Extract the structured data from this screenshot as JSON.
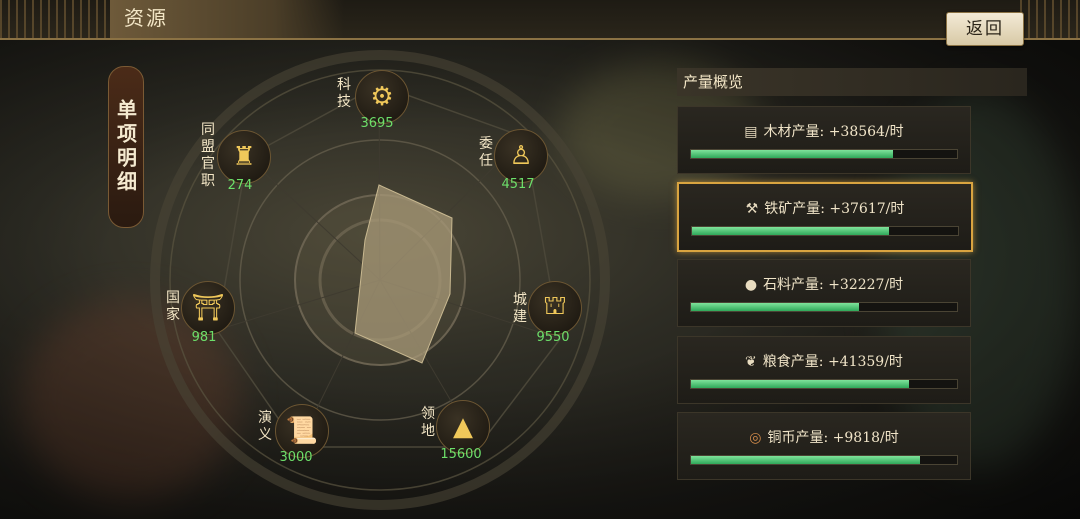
{
  "header": {
    "title": "资源",
    "back_label": "返回"
  },
  "side_tab": {
    "label": "单项明细"
  },
  "radar": {
    "nodes": [
      {
        "id": "tech",
        "label": "科技",
        "value": "3695",
        "icon": "gear-target-icon"
      },
      {
        "id": "appoint",
        "label": "委任",
        "value": "4517",
        "icon": "official-icon"
      },
      {
        "id": "city",
        "label": "城建",
        "value": "9550",
        "icon": "building-icon"
      },
      {
        "id": "territory",
        "label": "领地",
        "value": "15600",
        "icon": "mountain-icon"
      },
      {
        "id": "romance",
        "label": "演义",
        "value": "3000",
        "icon": "scroll-icon"
      },
      {
        "id": "nation",
        "label": "国家",
        "value": "981",
        "icon": "palace-icon"
      },
      {
        "id": "alliance",
        "label": "同盟官职",
        "value": "274",
        "icon": "robe-icon"
      }
    ]
  },
  "panel": {
    "title": "产量概览",
    "items": [
      {
        "label": "木材产量: +38564/时",
        "icon": "wood-icon",
        "fill": 0.76,
        "selected": false
      },
      {
        "label": "铁矿产量: +37617/时",
        "icon": "anvil-icon",
        "fill": 0.74,
        "selected": true
      },
      {
        "label": "石料产量: +32227/时",
        "icon": "stone-icon",
        "fill": 0.63,
        "selected": false
      },
      {
        "label": "粮食产量: +41359/时",
        "icon": "grain-icon",
        "fill": 0.82,
        "selected": false
      },
      {
        "label": "铜币产量: +9818/时",
        "icon": "coin-icon",
        "fill": 0.86,
        "selected": false
      }
    ]
  },
  "colors": {
    "accent_gold": "#d9a440",
    "value_green": "#6ddf6a",
    "bar_green": "#2fa85a"
  }
}
